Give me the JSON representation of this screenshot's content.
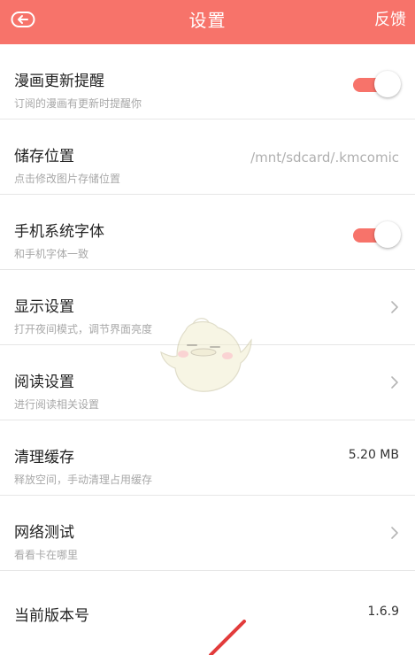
{
  "header": {
    "title": "设置",
    "feedback_label": "反馈",
    "background": "#f7736a",
    "back_icon": "back-icon"
  },
  "settings": [
    {
      "title": "漫画更新提醒",
      "subtitle": "订阅的漫画有更新时提醒你",
      "control": "toggle",
      "enabled": true
    },
    {
      "title": "储存位置",
      "subtitle": "点击修改图片存储位置",
      "control": "value",
      "value": "/mnt/sdcard/.kmcomic"
    },
    {
      "title": "手机系统字体",
      "subtitle": "和手机字体一致",
      "control": "toggle",
      "enabled": true
    },
    {
      "title": "显示设置",
      "subtitle": "打开夜间模式，调节界面亮度",
      "control": "chevron"
    },
    {
      "title": "阅读设置",
      "subtitle": "进行阅读相关设置",
      "control": "chevron"
    },
    {
      "title": "清理缓存",
      "subtitle": "释放空间，手动清理占用缓存",
      "control": "value",
      "value": "5.20 MB"
    },
    {
      "title": "网络测试",
      "subtitle": "看看卡在哪里",
      "control": "chevron"
    },
    {
      "title": "当前版本号",
      "control": "value",
      "value": "1.6.9"
    }
  ],
  "accent_color": "#f7736a"
}
